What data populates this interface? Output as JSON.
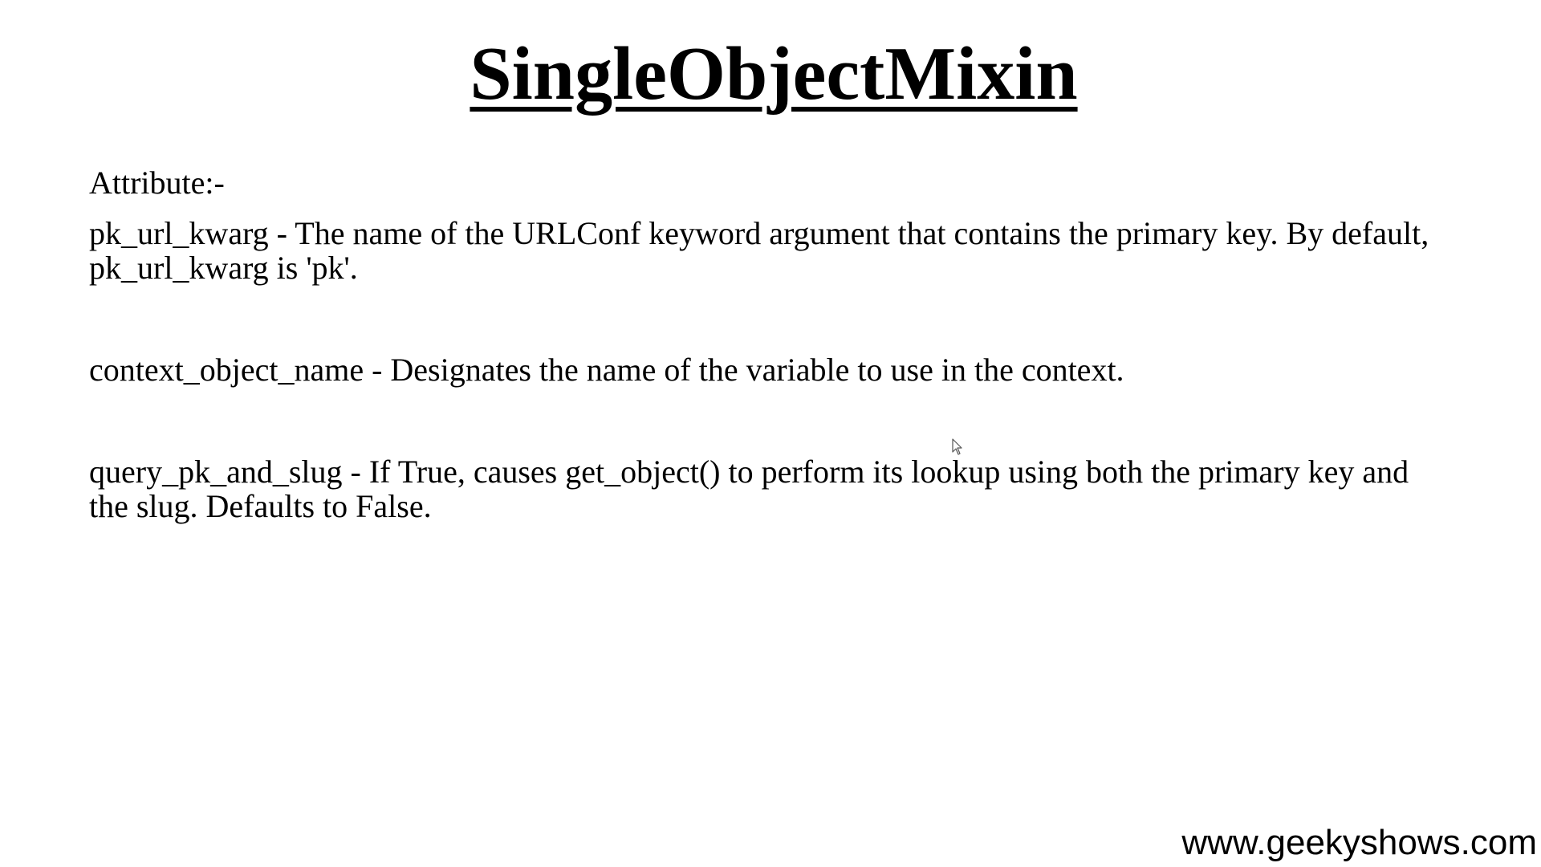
{
  "title": "SingleObjectMixin",
  "attributes_heading": "Attribute:-",
  "attributes": [
    "pk_url_kwarg - The name of the URLConf keyword argument that contains the primary key. By default, pk_url_kwarg is 'pk'.",
    "context_object_name - Designates the name of the variable to use in the context.",
    "query_pk_and_slug - If True, causes get_object() to perform its lookup using both the primary key and the slug. Defaults to False."
  ],
  "footer": {
    "website": "www.geekyshows.com"
  },
  "icons": {
    "cursor": "mouse-pointer-icon"
  }
}
